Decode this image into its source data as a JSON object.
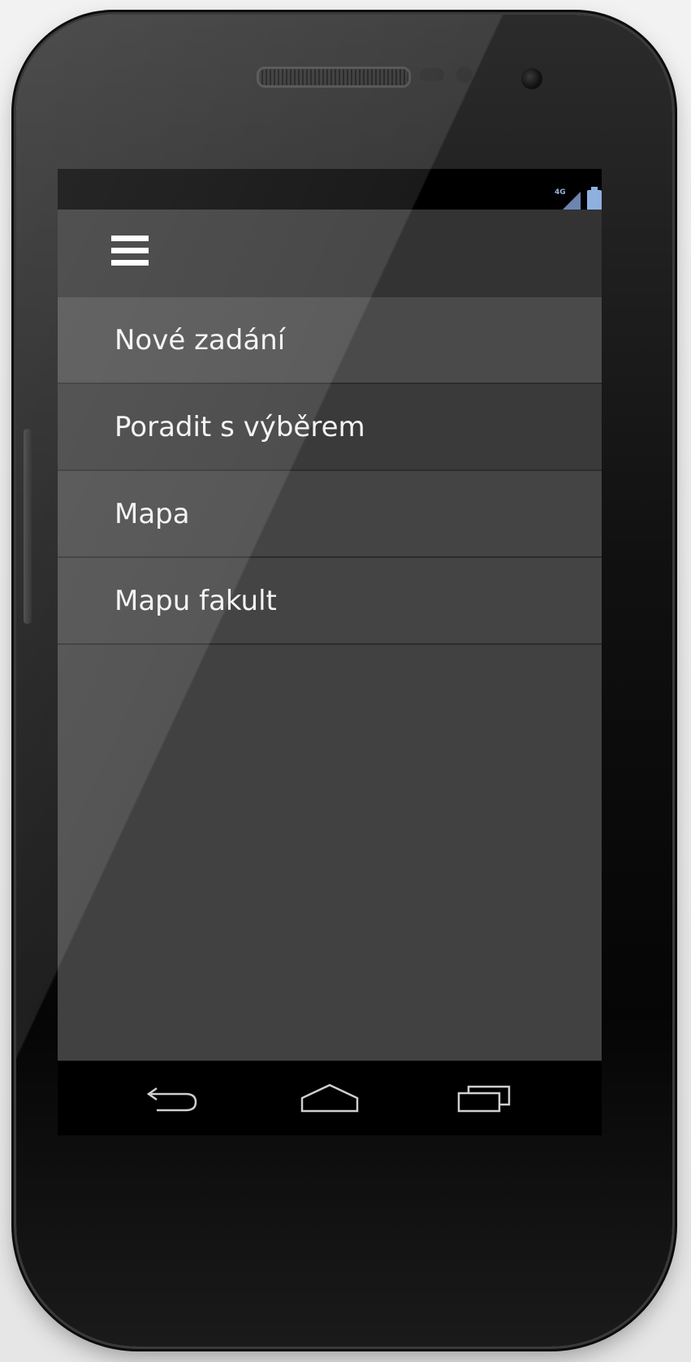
{
  "status_bar": {
    "network_type": "4G",
    "signal_icon": "signal-bars-icon",
    "battery_icon": "battery-icon",
    "icon_color": "#8fb0df"
  },
  "app_bar": {
    "menu_icon": "hamburger-menu-icon",
    "background": "#333333"
  },
  "menu": {
    "items": [
      {
        "label": "Nové zadání"
      },
      {
        "label": "Poradit s výběrem"
      },
      {
        "label": "Mapa"
      },
      {
        "label": "Mapu fakult"
      }
    ],
    "background": "#414141"
  },
  "nav_bar": {
    "back_icon": "back-icon",
    "home_icon": "home-icon",
    "recent_icon": "recent-apps-icon"
  }
}
